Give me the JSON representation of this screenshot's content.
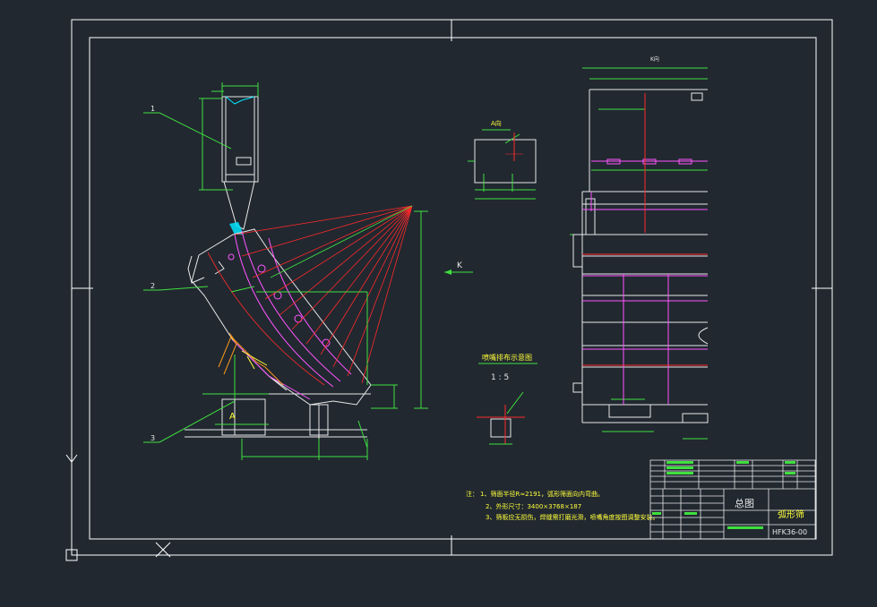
{
  "drawing": {
    "balloons": [
      "1",
      "2",
      "3"
    ],
    "section_label_a": "A",
    "view_k_arrow_label": "K",
    "view_k_label": "K向",
    "detail_a_label": "A向",
    "detail_nozzle_title": "喷嘴排布示意图",
    "detail_scale": "1 : 5",
    "notes_heading": "注：",
    "notes": [
      "1、筛面半径R≈2191，弧形筛面向内弯曲。",
      "2、外形尺寸：3400×3768×187",
      "3、筛板应无损伤，焊缝需打磨光滑，喷嘴角度按图调整安装。"
    ],
    "title_block": {
      "drawing_name": "总图",
      "product_name": "弧形筛",
      "drawing_number": "HFK36-00"
    },
    "ucs_y_label": "Y",
    "ucs_x_label": "X"
  },
  "colors": {
    "background": "#212830",
    "frame": "#ffffff",
    "outline": "#e8e8e8",
    "dimension": "#3fe03f",
    "hatch_red": "#ff2a2a",
    "magenta": "#ff55ff",
    "cyan": "#00e5ff",
    "yellow_text": "#ffff3a",
    "orange": "#ff9a1a"
  },
  "icons": [
    "ucs-axis-icon"
  ]
}
